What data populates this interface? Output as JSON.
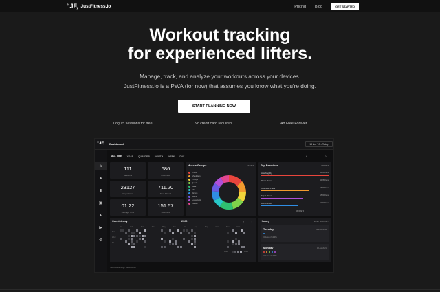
{
  "nav": {
    "logo_mark": "“JF,",
    "logo_text": "JustFitness.io",
    "links": [
      "Pricing",
      "Blog"
    ],
    "cta": "GET STARTED"
  },
  "hero": {
    "title_line1": "Workout tracking",
    "title_line2": "for experienced lifters.",
    "sub_line1": "Manage, track, and analyze your workouts across your devices.",
    "sub_line2": "JustFitness.io is a PWA (for now) that assumes you know what you're doing.",
    "cta": "START PLANNING NOW"
  },
  "features": [
    "Log 15 sessions for free",
    "No credit card required",
    "Ad Free Forever"
  ],
  "dashboard": {
    "logo_mark": "“JF,",
    "title": "Dashboard",
    "date_range": "18 Nov '19 – Today",
    "tabs": [
      "ALL TIME",
      "YEAR",
      "QUARTER",
      "MONTH",
      "WEEK",
      "DAY"
    ],
    "pager_prev": "‹",
    "pager_next": "›",
    "stats": [
      {
        "value": "111",
        "label": "Sessions"
      },
      {
        "value": "686",
        "label": "Exercises"
      },
      {
        "value": "23127",
        "label": "Repetitions"
      },
      {
        "value": "711.20",
        "label": "Tons Moved"
      },
      {
        "value": "01:22",
        "label": "Average Time"
      },
      {
        "value": "151:57",
        "label": "Total Time"
      }
    ],
    "muscle_groups": {
      "title": "Muscle Groups",
      "control": "SETS ▾",
      "items": [
        {
          "name": "Chest",
          "color": "#e8453c",
          "share": 14
        },
        {
          "name": "Shoulders",
          "color": "#f29a2e",
          "share": 11
        },
        {
          "name": "Triceps",
          "color": "#f2d43a",
          "share": 9
        },
        {
          "name": "Quads",
          "color": "#7fd14b",
          "share": 12
        },
        {
          "name": "Back",
          "color": "#2fbf71",
          "share": 13
        },
        {
          "name": "Abs",
          "color": "#28c8c8",
          "share": 8
        },
        {
          "name": "Biceps",
          "color": "#2f8de4",
          "share": 9
        },
        {
          "name": "Hams",
          "color": "#6a5be2",
          "share": 8
        },
        {
          "name": "Lowerback",
          "color": "#b04fd8",
          "share": 8
        },
        {
          "name": "Calves",
          "color": "#e2468f",
          "share": 8
        }
      ]
    },
    "top_exercises": {
      "title": "Top Exercises",
      "control": "REPS ▾",
      "items": [
        {
          "name": "Hatching Fly",
          "value": "3960 Reps",
          "color": "#e8453c",
          "fraction": 1.0
        },
        {
          "name": "Pinch Press",
          "value": "3425 Reps",
          "color": "#7fd14b",
          "fraction": 0.86
        },
        {
          "name": "Overhead Press",
          "value": "1630 Reps",
          "color": "#f29a2e",
          "fraction": 0.7
        },
        {
          "name": "Squat Press",
          "value": "1520 Reps",
          "color": "#b04fd8",
          "fraction": 0.62
        },
        {
          "name": "Bench Press",
          "value": "1381 Reps",
          "color": "#2f8de4",
          "fraction": 0.55
        }
      ],
      "more": "MORE ▾"
    },
    "consistency": {
      "title": "Consistency",
      "year": "2020",
      "months": [
        "Jan",
        "Feb",
        "Mar",
        "Apr",
        "May",
        "Jun",
        "Jul",
        "Aug",
        "Sep",
        "Oct",
        "Nov",
        "Dec"
      ],
      "days": [
        "Mon",
        "Wed",
        "Fri"
      ],
      "legend_less": "Less",
      "legend_more": "More"
    },
    "history": {
      "title": "History",
      "control": "FULL HISTORY",
      "entries": [
        {
          "day": "Tuesday",
          "meta": "Volume of 12 lifts",
          "right": "View Workout",
          "dots": [
            "#2f8de4"
          ]
        },
        {
          "day": "Monday",
          "meta": "Volume of 12 lifts",
          "right": "16 Apr 2021",
          "dots": [
            "#e8453c",
            "#f29a2e",
            "#7fd14b",
            "#2f8de4",
            "#b04fd8"
          ]
        }
      ]
    },
    "footer": "Need something?  Get in touch"
  }
}
